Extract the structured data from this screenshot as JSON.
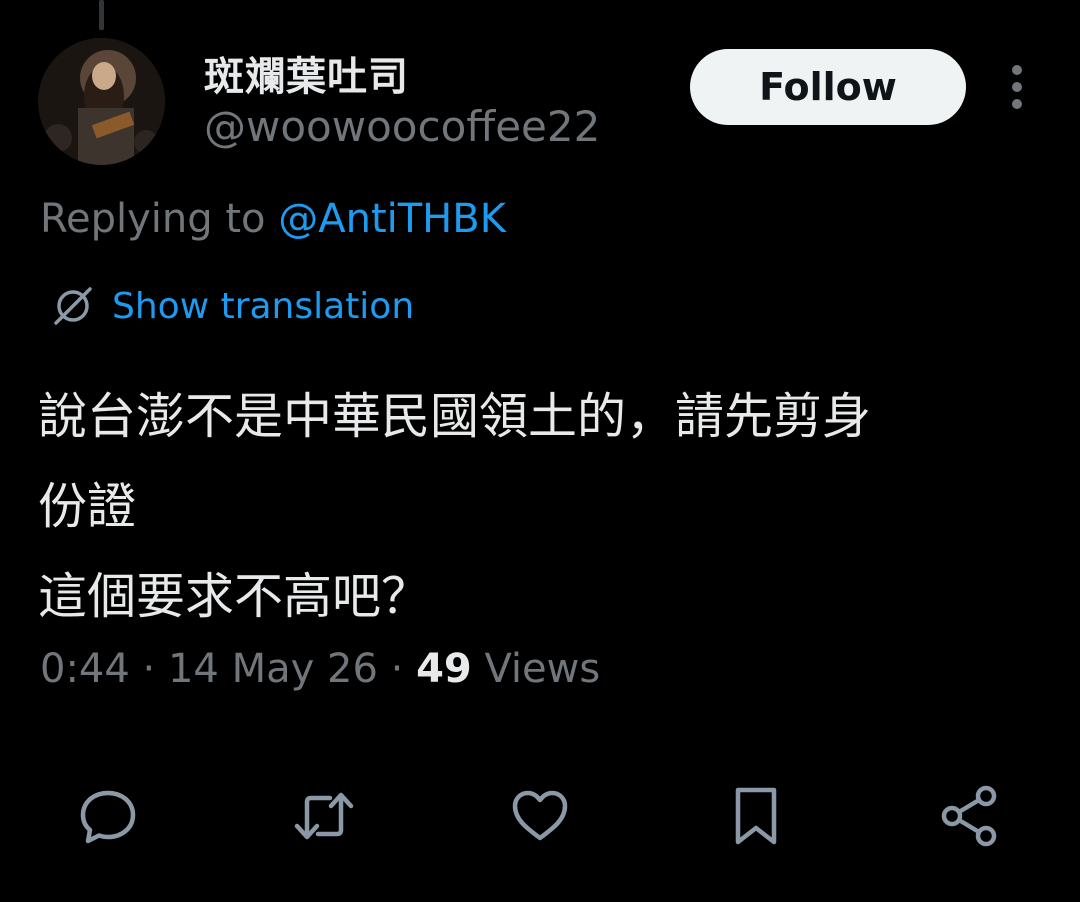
{
  "tweet": {
    "author": {
      "display_name": "斑斕葉吐司",
      "handle": "@woowoocoffee22"
    },
    "follow_label": "Follow",
    "replying_to_prefix": "Replying to ",
    "replying_to_handle": "@AntiTHBK",
    "show_translation_label": "Show translation",
    "text": "說台澎不是中華民國領土的，請先剪身\n份證\n這個要求不高吧？",
    "meta": {
      "time": "0:44",
      "separator": " · ",
      "date": "14 May 26",
      "views_count": "49",
      "views_label": " Views"
    }
  },
  "icons": {
    "more": "more-vertical-icon",
    "translate": "globe-slash-icon",
    "reply": "reply-icon",
    "retweet": "retweet-icon",
    "like": "heart-icon",
    "bookmark": "bookmark-icon",
    "share": "share-icon"
  },
  "colors": {
    "accent": "#1d9bf0",
    "text": "#e7e9ea",
    "muted": "#71767b",
    "background": "#000000"
  }
}
